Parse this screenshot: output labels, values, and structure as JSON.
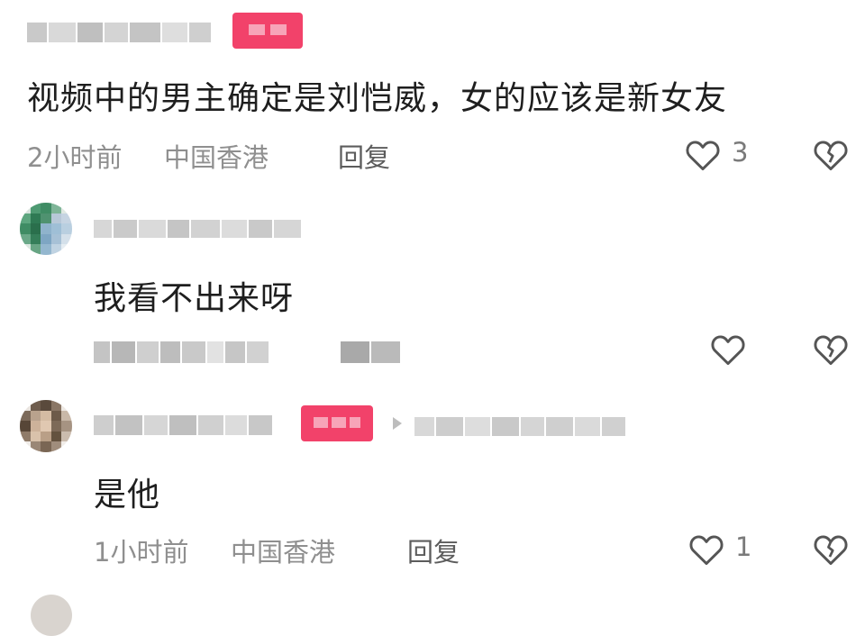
{
  "comments": [
    {
      "text": "视频中的男主确定是刘恺威，女的应该是新女友",
      "time": "2小时前",
      "location": "中国香港",
      "reply_label": "回复",
      "like_count": "3"
    },
    {
      "text": "我看不出来呀",
      "time": "",
      "location": "",
      "reply_label": "",
      "like_count": ""
    },
    {
      "text": "是他",
      "time": "1小时前",
      "location": "中国香港",
      "reply_label": "回复",
      "like_count": "1"
    }
  ],
  "icons": {
    "like": "heart-outline-icon",
    "dislike": "broken-heart-icon"
  },
  "colors": {
    "tag": "#f2426a",
    "meta_text": "#8f8f8f",
    "icon_stroke": "#555555"
  }
}
